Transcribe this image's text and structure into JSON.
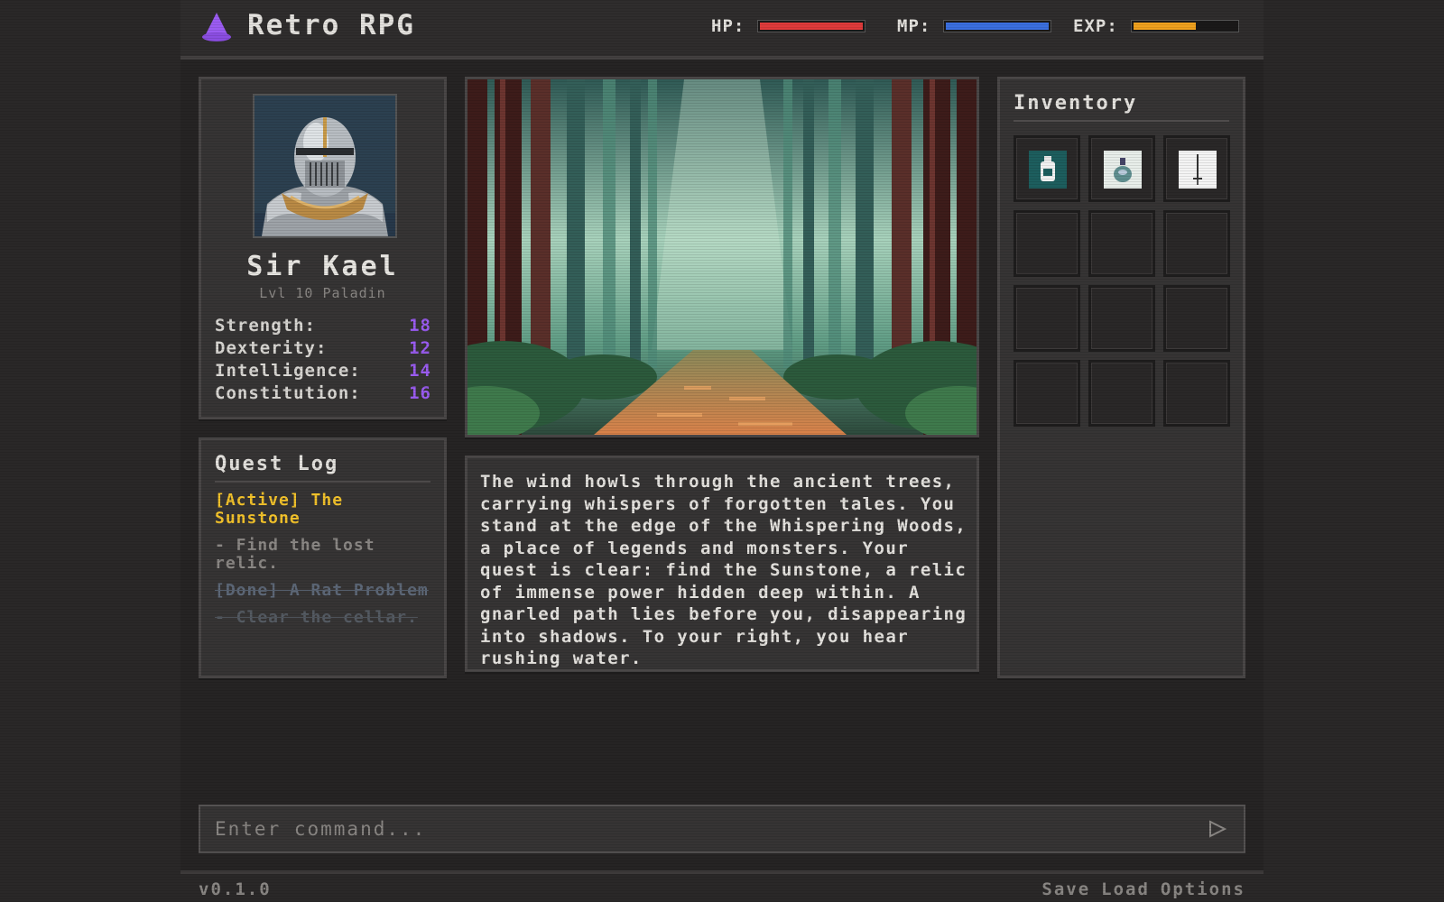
{
  "app": {
    "title": "Retro RPG"
  },
  "bars": [
    {
      "label": "HP:",
      "fill": 1.0,
      "color": "#e03b3b"
    },
    {
      "label": "MP:",
      "fill": 1.0,
      "color": "#3b6fe0"
    },
    {
      "label": "EXP:",
      "fill": 0.62,
      "color": "#f0a11e"
    }
  ],
  "character": {
    "name": "Sir Kael",
    "class": "Lvl 10 Paladin",
    "stats": [
      {
        "label": "Strength:",
        "value": "18"
      },
      {
        "label": "Dexterity:",
        "value": "12"
      },
      {
        "label": "Intelligence:",
        "value": "14"
      },
      {
        "label": "Constitution:",
        "value": "16"
      }
    ]
  },
  "quest_log": {
    "title": "Quest Log",
    "active_quest": "[Active] The Sunstone",
    "active_objective": "- Find the lost relic.",
    "done_quest": "[Done] A Rat Problem",
    "done_objective": "- Clear the cellar."
  },
  "narrative": "The wind howls through the ancient trees, carrying whispers of forgotten tales. You stand at the edge of the Whispering Woods, a place of legends and monsters. Your quest is clear: find the Sunstone, a relic of immense power hidden deep within. A gnarled path lies before you, disappearing into shadows. To your right, you hear rushing water.",
  "inventory": {
    "title": "Inventory",
    "items": [
      "potion-bottle-icon",
      "flask-icon",
      "sword-icon"
    ],
    "slot_count": 12
  },
  "command": {
    "placeholder": "Enter command..."
  },
  "footer": {
    "version": "v0.1.0",
    "save_label": "Save",
    "load_label": "Load",
    "options_label": "Options"
  },
  "colors": {
    "accent": "#9b5cf2",
    "active_quest": "#f2c22b"
  }
}
